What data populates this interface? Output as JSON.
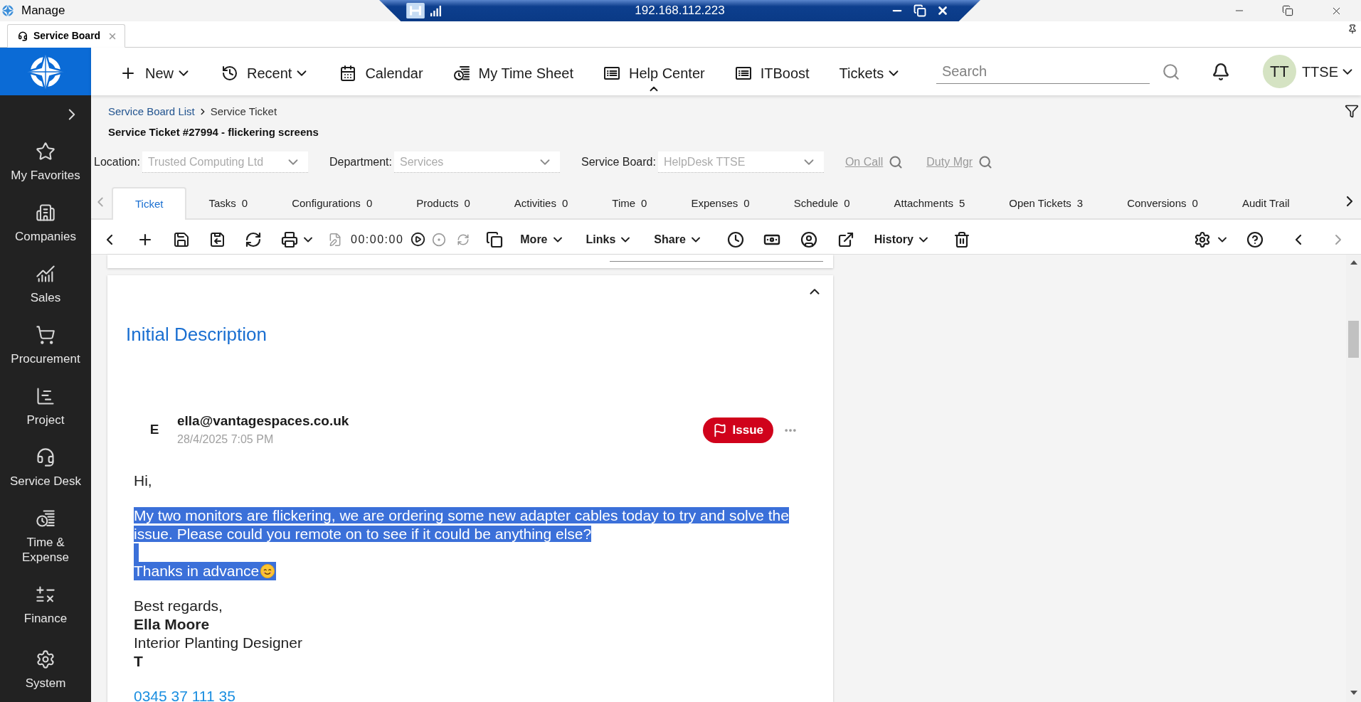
{
  "window": {
    "title": "Manage"
  },
  "remote_bar": {
    "address": "192.168.112.223"
  },
  "app_tabs": [
    {
      "label": "Service Board",
      "selected": true
    }
  ],
  "nav": {
    "items": [
      {
        "label": "New",
        "kind": "menu",
        "selected": false
      },
      {
        "label": "Recent",
        "kind": "menu",
        "selected": false
      },
      {
        "label": "Calendar",
        "kind": "link",
        "selected": false
      },
      {
        "label": "My Time Sheet",
        "kind": "link",
        "selected": false
      },
      {
        "label": "Help Center",
        "kind": "link",
        "selected": true
      },
      {
        "label": "ITBoost",
        "kind": "link",
        "selected": false
      },
      {
        "label": "Tickets",
        "kind": "menu",
        "selected": false
      }
    ],
    "search": {
      "placeholder": "Search"
    },
    "user": {
      "initials": "TT",
      "name": "TTSE"
    }
  },
  "sidebar": {
    "items": [
      {
        "label": "My Favorites"
      },
      {
        "label": "Companies"
      },
      {
        "label": "Sales"
      },
      {
        "label": "Procurement"
      },
      {
        "label": "Project"
      },
      {
        "label": "Service Desk"
      },
      {
        "label": "Time & Expense"
      },
      {
        "label": "Finance"
      },
      {
        "label": "System"
      }
    ]
  },
  "breadcrumb": [
    {
      "label": "Service Board List",
      "kind": "link"
    },
    {
      "label": "Service Ticket",
      "kind": "current"
    }
  ],
  "page_title": "Service Ticket #27994 - flickering screens",
  "filters": [
    {
      "label": "Location:",
      "value": "Trusted Computing Ltd"
    },
    {
      "label": "Department:",
      "value": "Services"
    },
    {
      "label": "Service Board:",
      "value": "HelpDesk TTSE"
    }
  ],
  "lookups": [
    {
      "label": "On Call"
    },
    {
      "label": "Duty Mgr"
    }
  ],
  "ticket_tabs": [
    {
      "label": "Ticket",
      "selected": true
    },
    {
      "label": "Tasks",
      "count": "0",
      "selected": false
    },
    {
      "label": "Configurations",
      "count": "0",
      "selected": false
    },
    {
      "label": "Products",
      "count": "0",
      "selected": false
    },
    {
      "label": "Activities",
      "count": "0",
      "selected": false
    },
    {
      "label": "Time",
      "count": "0",
      "selected": false
    },
    {
      "label": "Expenses",
      "count": "0",
      "selected": false
    },
    {
      "label": "Schedule",
      "count": "0",
      "selected": false
    },
    {
      "label": "Attachments",
      "count": "5",
      "selected": false
    },
    {
      "label": "Open Tickets",
      "count": "3",
      "selected": false
    },
    {
      "label": "Conversions",
      "count": "0",
      "selected": false
    },
    {
      "label": "Audit Trail",
      "selected": false
    }
  ],
  "toolbar": {
    "timer": "00:00:00",
    "menus": [
      {
        "label": "More"
      },
      {
        "label": "Links"
      },
      {
        "label": "Share"
      }
    ],
    "history": {
      "label": "History"
    }
  },
  "description": {
    "title": "Initial Description",
    "expanded": true,
    "message": {
      "initial": "E",
      "sender": "ella@vantagespaces.co.uk",
      "date": "28/4/2025 7:05 PM",
      "tag": "Issue",
      "paragraphs": [
        {
          "lines": [
            {
              "kind": "text",
              "text": "Hi,",
              "selected": false
            }
          ]
        },
        {
          "lines": [
            {
              "kind": "text",
              "text": "My two monitors are flickering, we are ordering some new adapter cables today to try and solve the",
              "selected": true
            },
            {
              "kind": "text",
              "text": "issue. Please could you remote on to see if it could be anything else?",
              "selected": true
            },
            {
              "kind": "blank",
              "selected": true
            },
            {
              "kind": "emoji",
              "text": "Thanks in advance",
              "selected": true
            }
          ]
        },
        {
          "lines": [
            {
              "kind": "text",
              "text": "Best regards,",
              "selected": false
            },
            {
              "kind": "strong",
              "text": "Ella Moore",
              "selected": false
            },
            {
              "kind": "text",
              "text": "Interior Planting Designer",
              "selected": false
            },
            {
              "kind": "strong",
              "text": "T",
              "selected": false
            }
          ]
        },
        {
          "lines": [
            {
              "kind": "link",
              "text": "0345 37 111 35",
              "selected": false
            }
          ]
        }
      ]
    }
  }
}
